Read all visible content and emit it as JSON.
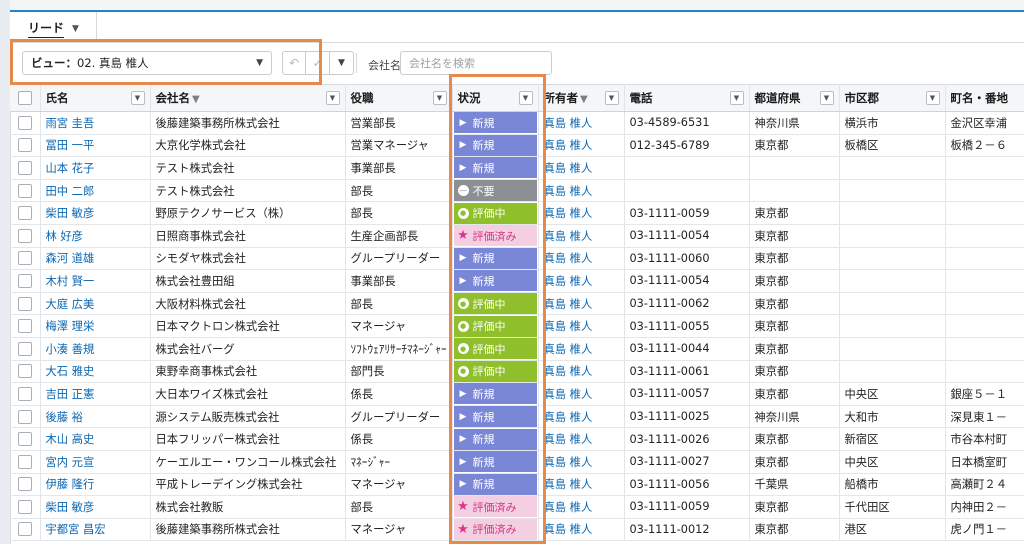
{
  "tab": {
    "label": "リード"
  },
  "toolbar": {
    "view_label": "ビュー：",
    "view_value": "02. 真島 椎人",
    "filter_label": "会社名",
    "filter_placeholder": "会社名を検索"
  },
  "columns": [
    "氏名",
    "会社名",
    "役職",
    "状況",
    "所有者",
    "電話",
    "都道府県",
    "市区郡",
    "町名・番地"
  ],
  "status_labels": {
    "new": "新規",
    "eval": "評価中",
    "done": "評価済み",
    "ng": "不要"
  },
  "colors": {
    "accent_orange": "#e58a4a",
    "status_new": "#7a86d6",
    "status_eval": "#8fbf2a",
    "status_done": "#f4cfe2",
    "status_ng": "#8c8f93"
  },
  "rows": [
    {
      "name": "雨宮 圭吾",
      "company": "後藤建築事務所株式会社",
      "title": "営業部長",
      "status": "new",
      "owner": "真島 椎人",
      "phone": "03-4589-6531",
      "pref": "神奈川県",
      "city": "横浜市",
      "street": "金沢区幸浦"
    },
    {
      "name": "冨田 一平",
      "company": "大京化学株式会社",
      "title": "営業マネージャ",
      "status": "new",
      "owner": "真島 椎人",
      "phone": "012-345-6789",
      "pref": "東京都",
      "city": "板橋区",
      "street": "板橋２－６"
    },
    {
      "name": "山本 花子",
      "company": "テスト株式会社",
      "title": "事業部長",
      "status": "new",
      "owner": "真島 椎人",
      "phone": "",
      "pref": "",
      "city": "",
      "street": ""
    },
    {
      "name": "田中 二郎",
      "company": "テスト株式会社",
      "title": "部長",
      "status": "ng",
      "owner": "真島 椎人",
      "phone": "",
      "pref": "",
      "city": "",
      "street": ""
    },
    {
      "name": "柴田 敏彦",
      "company": "野原テクノサービス（株）",
      "title": "部長",
      "status": "eval",
      "owner": "真島 椎人",
      "phone": "03-1111-0059",
      "pref": "東京都",
      "city": "",
      "street": ""
    },
    {
      "name": "林 好彦",
      "company": "日照商事株式会社",
      "title": "生産企画部長",
      "status": "done",
      "owner": "真島 椎人",
      "phone": "03-1111-0054",
      "pref": "東京都",
      "city": "",
      "street": ""
    },
    {
      "name": "森河 道雄",
      "company": "シモダヤ株式会社",
      "title": "グループリーダー",
      "status": "new",
      "owner": "真島 椎人",
      "phone": "03-1111-0060",
      "pref": "東京都",
      "city": "",
      "street": ""
    },
    {
      "name": "木村 賢一",
      "company": "株式会社豊田組",
      "title": "事業部長",
      "status": "new",
      "owner": "真島 椎人",
      "phone": "03-1111-0054",
      "pref": "東京都",
      "city": "",
      "street": ""
    },
    {
      "name": "大庭 広美",
      "company": "大阪材料株式会社",
      "title": "部長",
      "status": "eval",
      "owner": "真島 椎人",
      "phone": "03-1111-0062",
      "pref": "東京都",
      "city": "",
      "street": ""
    },
    {
      "name": "梅澤 理栄",
      "company": "日本マクトロン株式会社",
      "title": "マネージャ",
      "status": "eval",
      "owner": "真島 椎人",
      "phone": "03-1111-0055",
      "pref": "東京都",
      "city": "",
      "street": ""
    },
    {
      "name": "小湊 善規",
      "company": "株式会社バーグ",
      "title": "ｿﾌﾄｳｪｱﾘｻｰﾁﾏﾈｰｼﾞｬｰ",
      "status": "eval",
      "owner": "真島 椎人",
      "phone": "03-1111-0044",
      "pref": "東京都",
      "city": "",
      "street": ""
    },
    {
      "name": "大石 雅史",
      "company": "東野幸商事株式会社",
      "title": "部門長",
      "status": "eval",
      "owner": "真島 椎人",
      "phone": "03-1111-0061",
      "pref": "東京都",
      "city": "",
      "street": ""
    },
    {
      "name": "吉田 正憲",
      "company": "大日本ワイズ株式会社",
      "title": "係長",
      "status": "new",
      "owner": "真島 椎人",
      "phone": "03-1111-0057",
      "pref": "東京都",
      "city": "中央区",
      "street": "銀座５－１"
    },
    {
      "name": "後藤 裕",
      "company": "源システム販売株式会社",
      "title": "グループリーダー",
      "status": "new",
      "owner": "真島 椎人",
      "phone": "03-1111-0025",
      "pref": "神奈川県",
      "city": "大和市",
      "street": "深見東１－"
    },
    {
      "name": "木山 高史",
      "company": "日本フリッパー株式会社",
      "title": "係長",
      "status": "new",
      "owner": "真島 椎人",
      "phone": "03-1111-0026",
      "pref": "東京都",
      "city": "新宿区",
      "street": "市谷本村町"
    },
    {
      "name": "宮内 元宣",
      "company": "ケーエルエー・ワンコール株式会社",
      "title": "ﾏﾈｰｼﾞｬｰ",
      "status": "new",
      "owner": "真島 椎人",
      "phone": "03-1111-0027",
      "pref": "東京都",
      "city": "中央区",
      "street": "日本橋室町"
    },
    {
      "name": "伊藤 隆行",
      "company": "平成トレーデイング株式会社",
      "title": "マネージャ",
      "status": "new",
      "owner": "真島 椎人",
      "phone": "03-1111-0056",
      "pref": "千葉県",
      "city": "船橋市",
      "street": "高瀬町２４"
    },
    {
      "name": "柴田 敏彦",
      "company": "株式会社教販",
      "title": "部長",
      "status": "done",
      "owner": "真島 椎人",
      "phone": "03-1111-0059",
      "pref": "東京都",
      "city": "千代田区",
      "street": "内神田２－"
    },
    {
      "name": "宇都宮 昌宏",
      "company": "後藤建築事務所株式会社",
      "title": "マネージャ",
      "status": "done",
      "owner": "真島 椎人",
      "phone": "03-1111-0012",
      "pref": "東京都",
      "city": "港区",
      "street": "虎ノ門１－"
    }
  ]
}
